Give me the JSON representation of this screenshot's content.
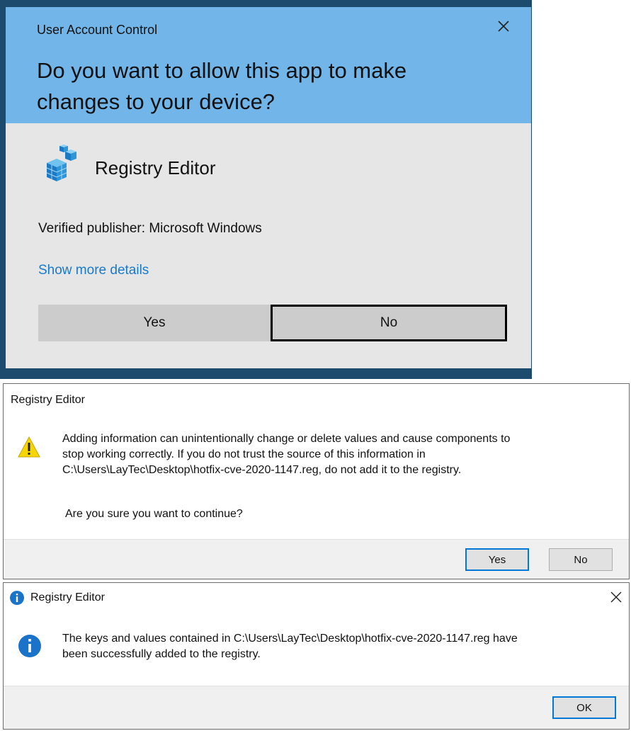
{
  "uac": {
    "title": "User Account Control",
    "question": "Do you want to allow this app to make changes to your device?",
    "app_name": "Registry Editor",
    "publisher": "Verified publisher: Microsoft Windows",
    "details_link": "Show more details",
    "yes_label": "Yes",
    "no_label": "No",
    "icons": {
      "close": "close-icon",
      "app": "registry-editor-icon"
    },
    "colors": {
      "header": "#72b5e8",
      "body": "#e6e6e6",
      "frame": "#1c4b6e",
      "link": "#1a79c9"
    }
  },
  "warning_dialog": {
    "title": "Registry Editor",
    "message_line1": "Adding information can unintentionally change or delete values and cause components to",
    "message_line2": "stop working correctly. If you do not trust the source of this information in",
    "message_line3": "C:\\Users\\LayTec\\Desktop\\hotfix-cve-2020-1147.reg, do not add it to the registry.",
    "question": "Are you sure you want to continue?",
    "yes_label": "Yes",
    "no_label": "No",
    "icon": "warning-icon"
  },
  "info_dialog": {
    "title": "Registry Editor",
    "message_line1": "The keys and values contained in C:\\Users\\LayTec\\Desktop\\hotfix-cve-2020-1147.reg have",
    "message_line2": "been successfully added to the registry.",
    "ok_label": "OK",
    "icons": {
      "title": "info-icon",
      "message": "info-icon",
      "close": "close-icon"
    }
  }
}
